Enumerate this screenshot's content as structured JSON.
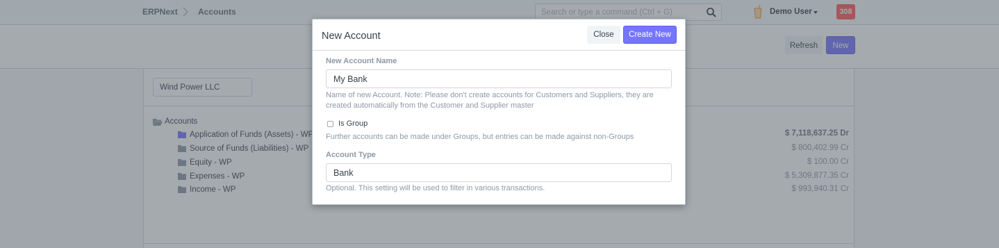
{
  "navbar": {
    "brand": "ERPNext",
    "breadcrumb": "Accounts",
    "search_placeholder": "Search or type a command (Ctrl + G)",
    "user": "Demo User",
    "notifications": "308"
  },
  "toolbar": {
    "refresh_label": "Refresh",
    "new_label": "New"
  },
  "company_filter": "Wind Power LLC",
  "tree": {
    "root": "Accounts",
    "items": [
      {
        "label": "Application of Funds (Assets) - WP",
        "balance": "$ 7,118,637.25 Dr",
        "color": "#7575ff"
      },
      {
        "label": "Source of Funds (Liabilities) - WP",
        "balance": "$ 800,402.99 Cr"
      },
      {
        "label": "Equity - WP",
        "balance": "$ 100.00 Cr"
      },
      {
        "label": "Expenses - WP",
        "balance": "$ 5,309,877.35 Cr"
      },
      {
        "label": "Income - WP",
        "balance": "$ 993,940.31 Cr"
      }
    ]
  },
  "modal": {
    "title": "New Account",
    "close_label": "Close",
    "create_label": "Create New",
    "account_name_label": "New Account Name",
    "account_name_value": "My Bank",
    "account_name_help": "Name of new Account. Note: Please don't create accounts for Customers and Suppliers, they are created automatically from the Customer and Supplier master",
    "is_group_label": "Is Group",
    "is_group_help": "Further accounts can be made under Groups, but entries can be made against non-Groups",
    "account_type_label": "Account Type",
    "account_type_value": "Bank",
    "account_type_help": "Optional. This setting will be used to filter in various transactions."
  },
  "colors": {
    "primary": "#7575ff",
    "danger": "#ff5858",
    "folder": "#8d99a6"
  }
}
